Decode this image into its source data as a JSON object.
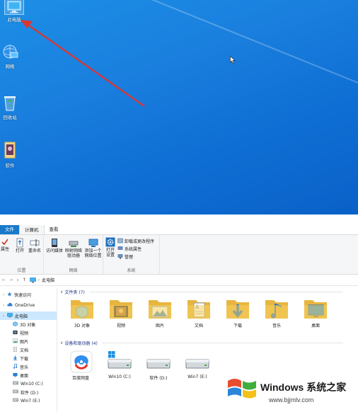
{
  "desktop": {
    "icons": [
      {
        "label": "此电脑",
        "icon": "this-pc-icon"
      },
      {
        "label": "网络",
        "icon": "network-icon"
      },
      {
        "label": "回收站",
        "icon": "recycle-bin-icon"
      },
      {
        "label": "软件",
        "icon": "software-folder-icon"
      }
    ],
    "annotation": "red-arrow pointing to 此电脑",
    "background": "#1a7fde"
  },
  "explorer": {
    "tabs": [
      "文件",
      "计算机",
      "查看"
    ],
    "active_tab": "计算机",
    "ribbon": {
      "location_group": {
        "title": "位置",
        "buttons": [
          "属性",
          "打开",
          "重命名"
        ]
      },
      "network_group": {
        "title": "网络",
        "buttons": [
          "访问媒体",
          "映射网络驱动器",
          "添加一个网络位置"
        ],
        "button_lines": [
          [
            "访问媒体",
            ""
          ],
          [
            "映射网络",
            "驱动器"
          ],
          [
            "添加一个",
            "网络位置"
          ]
        ]
      },
      "system_group": {
        "title": "系统",
        "open_settings": [
          "打开",
          "设置"
        ],
        "items": [
          "卸载或更改程序",
          "系统属性",
          "管理"
        ]
      }
    },
    "address": {
      "path": "此电脑",
      "nav": [
        "←",
        "→",
        "∨",
        "↑"
      ]
    },
    "nav_pane": [
      {
        "label": "快速访问",
        "icon": "star-icon",
        "level": 0
      },
      {
        "label": "OneDrive",
        "icon": "cloud-icon",
        "level": 0
      },
      {
        "label": "此电脑",
        "icon": "pc-icon",
        "level": 0,
        "selected": true
      },
      {
        "label": "3D 对象",
        "icon": "3d-icon",
        "level": 1
      },
      {
        "label": "视频",
        "icon": "video-icon",
        "level": 1
      },
      {
        "label": "图片",
        "icon": "picture-icon",
        "level": 1
      },
      {
        "label": "文档",
        "icon": "document-icon",
        "level": 1
      },
      {
        "label": "下载",
        "icon": "download-icon",
        "level": 1
      },
      {
        "label": "音乐",
        "icon": "music-icon",
        "level": 1
      },
      {
        "label": "桌面",
        "icon": "desktop-icon",
        "level": 1
      },
      {
        "label": "Win10 (C:)",
        "icon": "drive-icon",
        "level": 1
      },
      {
        "label": "软件 (D:)",
        "icon": "drive-icon",
        "level": 1
      },
      {
        "label": "Win7 (E:)",
        "icon": "drive-icon",
        "level": 1
      }
    ],
    "folders_header": "文件夹 (7)",
    "folders": [
      {
        "label": "3D 对象",
        "icon": "3d-objects-folder-icon"
      },
      {
        "label": "视频",
        "icon": "videos-folder-icon"
      },
      {
        "label": "图片",
        "icon": "pictures-folder-icon"
      },
      {
        "label": "文档",
        "icon": "documents-folder-icon"
      },
      {
        "label": "下载",
        "icon": "downloads-folder-icon"
      },
      {
        "label": "音乐",
        "icon": "music-folder-icon"
      },
      {
        "label": "桌面",
        "icon": "desktop-folder-icon"
      }
    ],
    "devices_header": "设备和驱动器 (4)",
    "devices": [
      {
        "label": "百度网盘",
        "icon": "baidu-netdisk-icon"
      },
      {
        "label": "Win10 (C:)",
        "icon": "system-drive-icon"
      },
      {
        "label": "软件 (D:)",
        "icon": "drive-icon"
      },
      {
        "label": "Win7 (E:)",
        "icon": "drive-icon"
      }
    ]
  },
  "watermark": {
    "title": "Windows 系统之家",
    "url": "www.bjjmlv.com"
  },
  "colors": {
    "file_tab": "#1979ca",
    "selection": "#cce8ff",
    "folder": "#f4c64e",
    "arrow": "#e0342d",
    "section_header": "#1e3287"
  }
}
